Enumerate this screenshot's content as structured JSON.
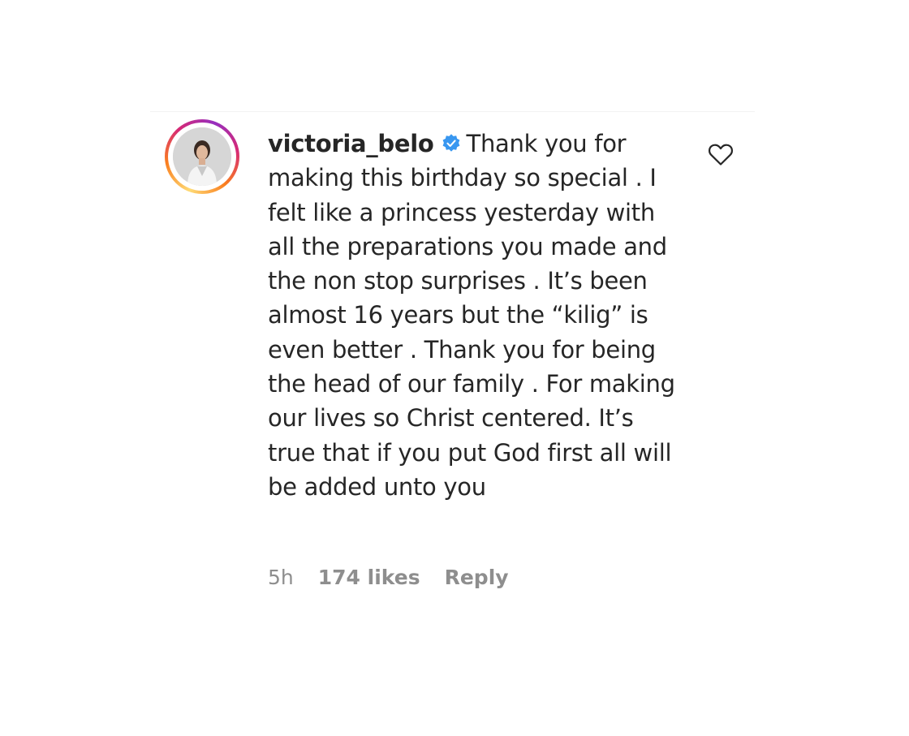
{
  "comment": {
    "username": "victoria_belo",
    "verified": true,
    "verified_icon": "verified-badge-icon",
    "text": "Thank you for making this birthday so special . I felt like a princess yesterday with all the preparations you made and the non stop surprises . It’s been almost 16 years but the “kilig” is even better . Thank you for being the head of our family . For making our lives so Christ centered. It’s true that if you put God first all will be added unto you",
    "time": "5h",
    "likes": "174 likes",
    "reply_label": "Reply",
    "like_icon": "heart-outline-icon"
  },
  "colors": {
    "text": "#262626",
    "meta": "#8e8e8e",
    "verified_blue": "#3897f0"
  }
}
